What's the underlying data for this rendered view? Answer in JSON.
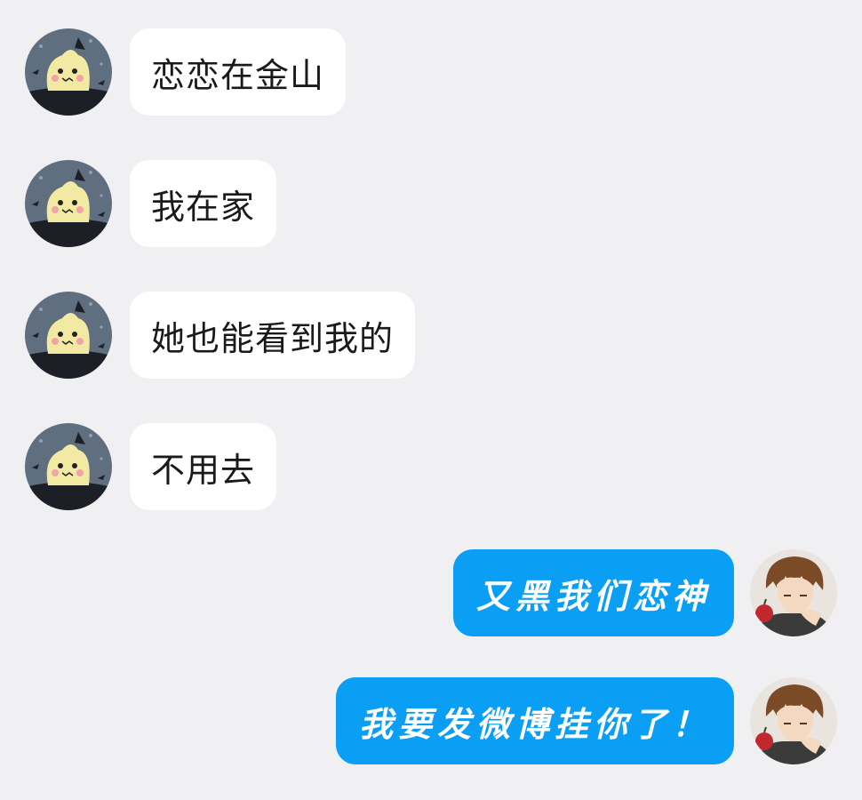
{
  "conversation": {
    "incoming": [
      {
        "text": "恋恋在金山",
        "avatar": "mimikyu-halloween-avatar"
      },
      {
        "text": "我在家",
        "avatar": "mimikyu-halloween-avatar"
      },
      {
        "text": "她也能看到我的",
        "avatar": "mimikyu-halloween-avatar"
      },
      {
        "text": "不用去",
        "avatar": "mimikyu-halloween-avatar"
      }
    ],
    "outgoing": [
      {
        "text": "又黑我们恋神",
        "avatar": "anime-boy-avatar"
      },
      {
        "text": "我要发微博挂你了！",
        "avatar": "anime-boy-avatar"
      }
    ]
  },
  "colors": {
    "background": "#f0f0f3",
    "incoming_bubble": "#ffffff",
    "outgoing_bubble": "#0a9ff5"
  }
}
